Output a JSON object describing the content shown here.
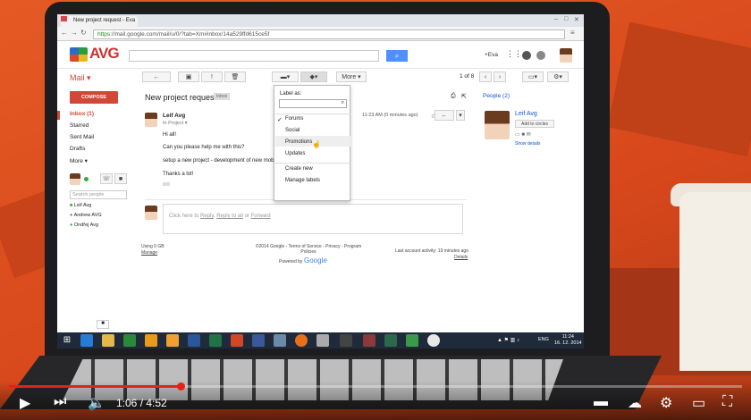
{
  "browser": {
    "tab_title": "New project request - Eva",
    "url_secure": "https",
    "url_rest": "://mail.google.com/mail/u/0/?tab=Xm#inbox/14a529ffd615ce5f"
  },
  "gmail": {
    "logo": "AVG",
    "account": "+Eva",
    "mail_label": "Mail ▾",
    "compose": "COMPOSE",
    "nav": [
      "Inbox (1)",
      "Starred",
      "Sent Mail",
      "Drafts",
      "More ▾"
    ],
    "chat_search_placeholder": "Search people",
    "contacts": [
      "Leif Avg",
      "Andrew AVG",
      "Ondřej Avg"
    ],
    "toolbar_more": "More ▾",
    "pager": "1 of 8",
    "subject": "New project request",
    "inbox_tag": "Inbox",
    "sender": "Leif Avg",
    "to_line": "to Project ▾",
    "timestamp": "11:23 AM (0 minutes ago)",
    "body_lines": [
      "Hi all!",
      "Can you please help me with this?",
      "setup a new project - development of new mob",
      "Thanks a lot!"
    ],
    "reply_prompt_pre": "Click here to ",
    "reply_link": "Reply",
    "reply_sep1": ", ",
    "reply_all_link": "Reply to all",
    "reply_sep2": " or ",
    "forward_link": "Forward",
    "storage": "Using 0 GB",
    "manage": "Manage",
    "footer_center": "©2014 Google - Terms of Service - Privacy - Program Policies",
    "powered": "Powered by",
    "powered_brand": "Google",
    "last_activity": "Last account activity: 19 minutes ago",
    "details": "Details",
    "people_header": "People (2)",
    "card_name": "Leif Avg",
    "add_circles": "Add to circles",
    "show_details": "Show details"
  },
  "label_menu": {
    "title": "Label as:",
    "items": [
      "Forums",
      "Social",
      "Promotions",
      "Updates"
    ],
    "checked": "Forums",
    "highlighted": "Social",
    "actions": [
      "Create new",
      "Manage labels"
    ]
  },
  "taskbar": {
    "time": "11:24",
    "date": "16. 12. 2014",
    "lang": "ENG"
  },
  "player": {
    "current": "1:06",
    "duration": "4:52",
    "time_display": "1:06 / 4:52",
    "progress": 0.234
  },
  "colors": {
    "accent_red": "#d14836",
    "search_blue": "#4d90fe",
    "progress_red": "#e62117",
    "scene_orange": "#d8481c"
  }
}
